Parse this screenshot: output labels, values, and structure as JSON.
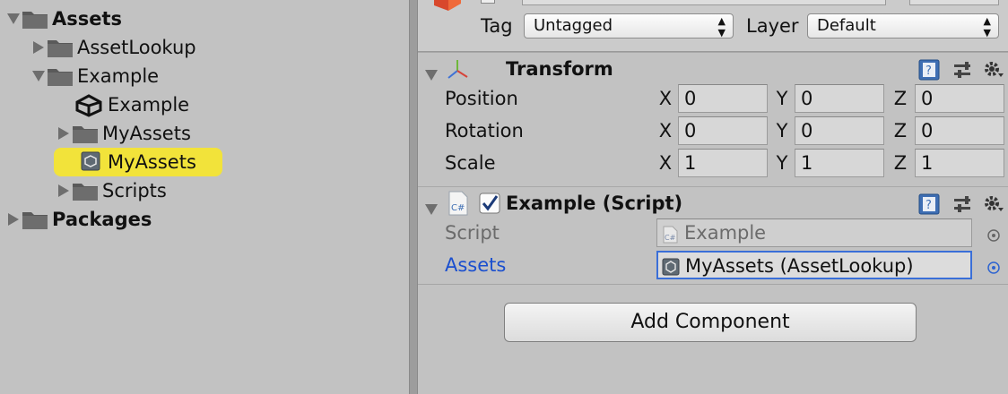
{
  "project": {
    "items": [
      {
        "label": "Assets",
        "bold": true,
        "icon": "folder-icon",
        "expanded": true
      },
      {
        "label": "AssetLookup",
        "bold": false,
        "icon": "folder-icon",
        "expanded": false
      },
      {
        "label": "Example",
        "bold": false,
        "icon": "folder-icon",
        "expanded": true
      },
      {
        "label": "Example",
        "bold": false,
        "icon": "unity-scene-icon"
      },
      {
        "label": "MyAssets",
        "bold": false,
        "icon": "folder-icon",
        "expanded": false
      },
      {
        "label": "MyAssets",
        "bold": false,
        "icon": "scriptable-object-icon",
        "selected": true
      },
      {
        "label": "Scripts",
        "bold": false,
        "icon": "folder-icon",
        "expanded": false
      },
      {
        "label": "Packages",
        "bold": true,
        "icon": "folder-icon",
        "expanded": false
      }
    ],
    "selected_color": "#f2e33a"
  },
  "inspector": {
    "tag_label": "Tag",
    "tag_value": "Untagged",
    "layer_label": "Layer",
    "layer_value": "Default",
    "transform": {
      "title": "Transform",
      "rows": [
        {
          "label": "Position",
          "x": "0",
          "y": "0",
          "z": "0"
        },
        {
          "label": "Rotation",
          "x": "0",
          "y": "0",
          "z": "0"
        },
        {
          "label": "Scale",
          "x": "1",
          "y": "1",
          "z": "1"
        }
      ],
      "axis_labels": [
        "X",
        "Y",
        "Z"
      ]
    },
    "script_component": {
      "title": "Example (Script)",
      "enabled": true,
      "script_label": "Script",
      "script_value": "Example",
      "assets_label": "Assets",
      "assets_value": "MyAssets (AssetLookup)",
      "assets_label_color": "#1a4fcf"
    },
    "add_component_label": "Add Component"
  }
}
